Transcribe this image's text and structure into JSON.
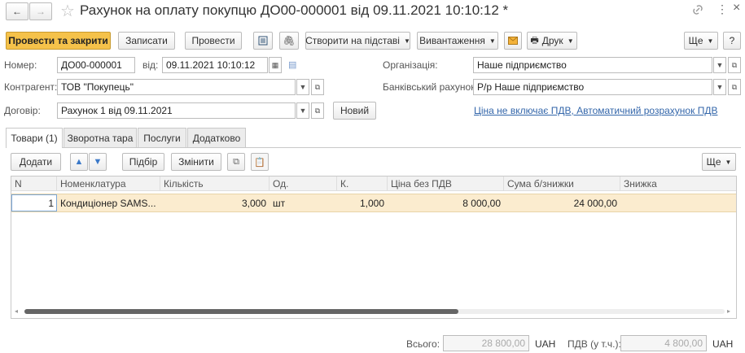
{
  "window": {
    "title": "Рахунок на оплату покупцю ДО00-000001 від 09.11.2021 10:10:12 *",
    "nav_back": "←",
    "nav_forward": "→",
    "star": "☆",
    "link_icon": "🔗",
    "menu_icon": "⋮",
    "close_icon": "×"
  },
  "toolbar": {
    "post_close": "Провести та закрити",
    "save": "Записати",
    "post": "Провести",
    "create_basis": "Створити на підставі",
    "export": "Вивантаження",
    "print": "Друк",
    "more": "Ще",
    "help": "?"
  },
  "header": {
    "number_label": "Номер:",
    "number_value": "ДО00-000001",
    "date_label": "від:",
    "date_value": "09.11.2021 10:10:12",
    "org_label": "Організація:",
    "org_value": "Наше підприємство",
    "counterparty_label": "Контрагент:",
    "counterparty_value": "ТОВ \"Покупець\"",
    "bank_label": "Банківський рахунок:",
    "bank_value": "Р/р Наше підприємство",
    "contract_label": "Договір:",
    "contract_value": "Рахунок 1 від 09.11.2021",
    "new_button": "Новий",
    "vat_link": "Ціна не включає ПДВ, Автоматичний розрахунок ПДВ"
  },
  "tabs": [
    {
      "label": "Товари (1)"
    },
    {
      "label": "Зворотна тара"
    },
    {
      "label": "Послуги"
    },
    {
      "label": "Додатково"
    }
  ],
  "table_toolbar": {
    "add": "Додати",
    "pick": "Підбір",
    "change": "Змінити",
    "more": "Ще"
  },
  "table": {
    "columns": [
      "N",
      "Номенклатура",
      "Кількість",
      "Од.",
      "К.",
      "Ціна без ПДВ",
      "Сума б/знижки",
      "Знижка"
    ],
    "rows": [
      [
        "1",
        "Кондиціонер SAMS...",
        "3,000",
        "шт",
        "1,000",
        "8 000,00",
        "24 000,00",
        ""
      ]
    ]
  },
  "scroll": {
    "thumb_fraction": 0.62
  },
  "footer": {
    "total_label": "Всього:",
    "total_value": "28 800,00",
    "currency": "UAH",
    "vat_label": "ПДВ (у т.ч.):",
    "vat_value": "4 800,00",
    "currency2": "UAH"
  },
  "colors": {
    "primary_button": "#f5c24a",
    "selected_row": "#fbeccf",
    "link": "#3366aa"
  }
}
